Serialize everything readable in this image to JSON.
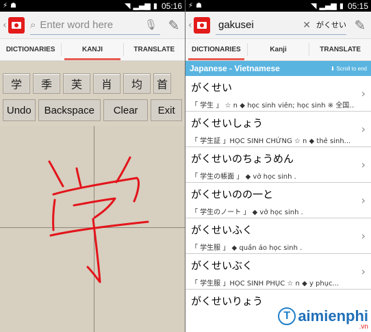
{
  "left": {
    "status": {
      "time": "05:16"
    },
    "search": {
      "placeholder": "Enter word here"
    },
    "tabs": [
      {
        "label": "DICTIONARIES"
      },
      {
        "label": "KANJI"
      },
      {
        "label": "TRANSLATE"
      }
    ],
    "active_tab": "KANJI",
    "kanji_candidates": [
      "学",
      "季",
      "芙",
      "肖",
      "均",
      "首"
    ],
    "commands": {
      "undo": "Undo",
      "backspace": "Backspace",
      "clear": "Clear",
      "exit": "Exit"
    }
  },
  "right": {
    "status": {
      "time": "05:15"
    },
    "search": {
      "value": "gakusei",
      "suggestion": "がくせい"
    },
    "tabs": [
      {
        "label": "DICTIONARIES"
      },
      {
        "label": "Kanji"
      },
      {
        "label": "TRANSLATE"
      }
    ],
    "active_tab": "DICTIONARIES",
    "dictionary": {
      "title": "Japanese - Vietnamese",
      "scroll_hint": "Scroll to end"
    },
    "entries": [
      {
        "word": "がくせい",
        "meaning": "「 学生 」 ☆ n ◆ học sinh viên; học sinh ※ 全国..."
      },
      {
        "word": "がくせいしょう",
        "meaning": "「 学生証 」HỌC SINH CHỨNG ☆ n ◆ thẻ sinh..."
      },
      {
        "word": "がくせいのちょうめん",
        "meaning": "「 学生の帳面 」 ◆ vở học sinh ."
      },
      {
        "word": "がくせいのの一と",
        "meaning": "「 学生のノート 」 ◆ vở học sinh ."
      },
      {
        "word": "がくせいふく",
        "meaning": "「 学生服 」 ◆ quần áo học sinh ."
      },
      {
        "word": "がくせいぶく",
        "meaning": "「 学生服 」HỌC SINH PHỤC ☆ n ◆ y phục..."
      },
      {
        "word": "がくせいりょう",
        "meaning": ""
      }
    ]
  },
  "watermark": {
    "brand": "aimienphi",
    "domain": ".vn",
    "logo_letter": "T"
  },
  "colors": {
    "accent_red": "#e31b1b",
    "tab_underline": "#e85a4f",
    "header_blue": "#5ab4e0",
    "stroke_red": "#e3141b"
  }
}
